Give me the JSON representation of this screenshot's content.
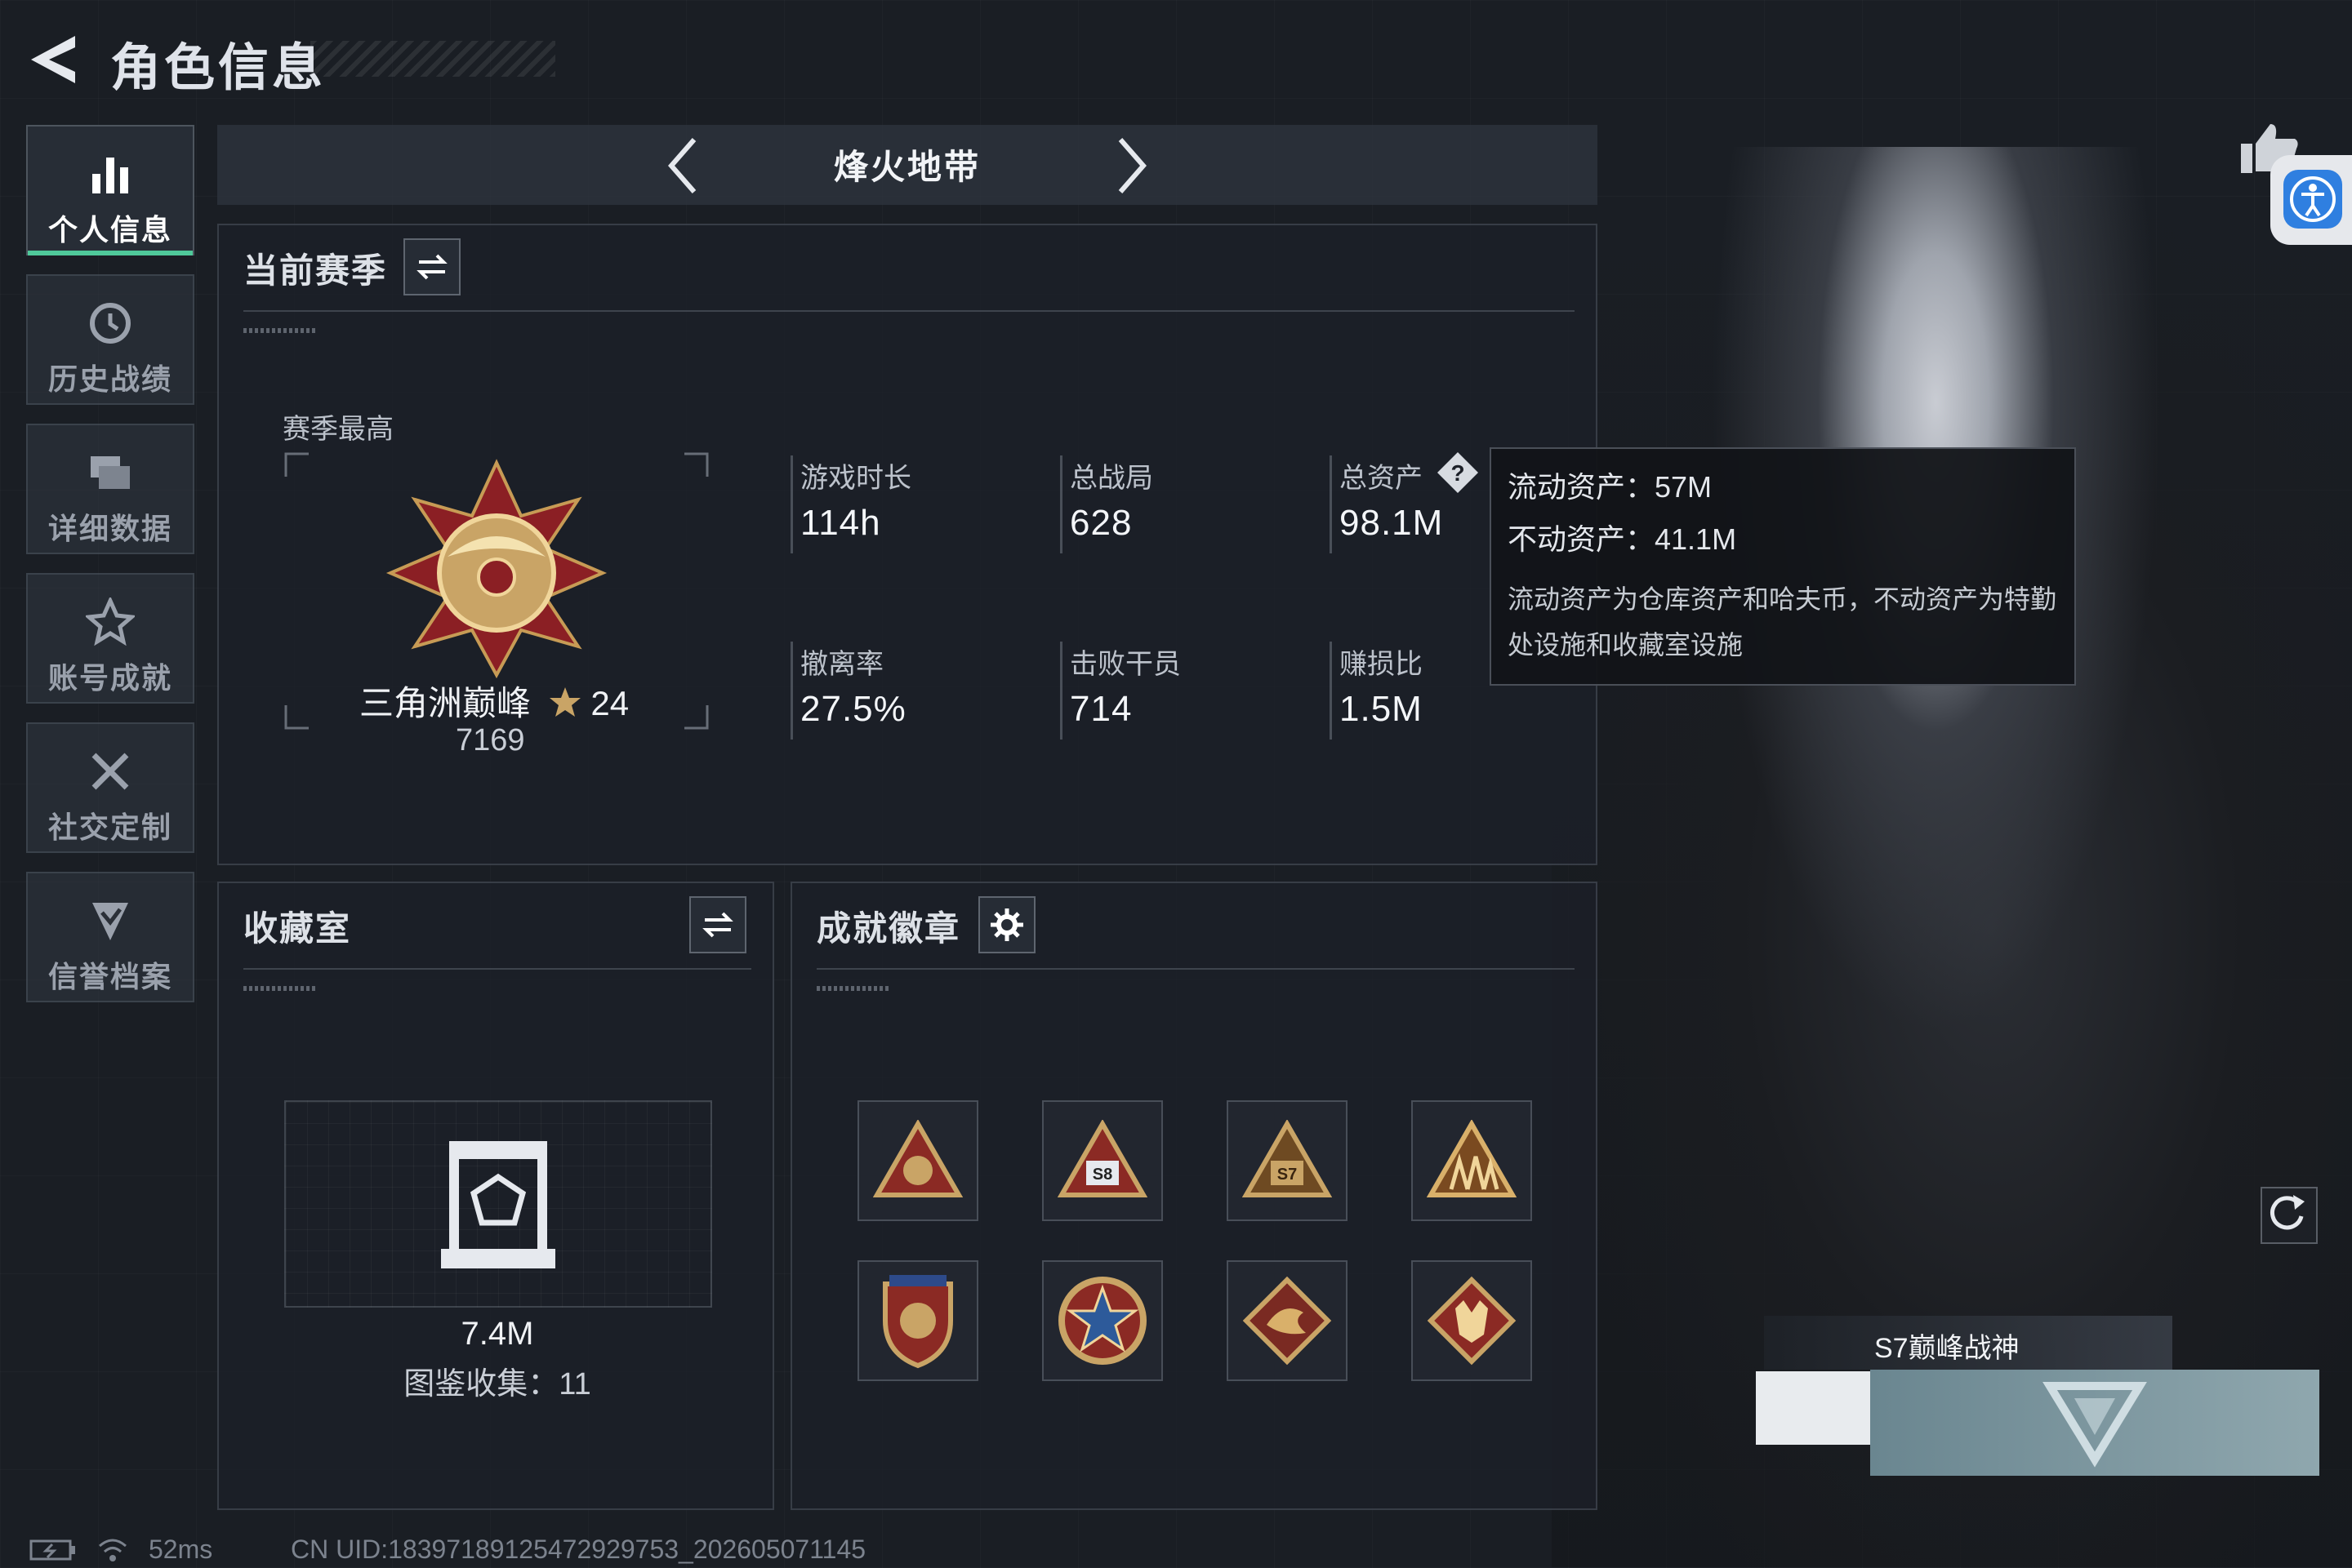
{
  "header": {
    "title": "角色信息"
  },
  "sidebar": {
    "items": [
      {
        "label": "个人信息",
        "icon": "bar-chart-icon",
        "active": true
      },
      {
        "label": "历史战绩",
        "icon": "history-clock-icon",
        "active": false
      },
      {
        "label": "详细数据",
        "icon": "folders-icon",
        "active": false
      },
      {
        "label": "账号成就",
        "icon": "achievement-star-icon",
        "active": false
      },
      {
        "label": "社交定制",
        "icon": "tools-icon",
        "active": false
      },
      {
        "label": "信誉档案",
        "icon": "shield-check-icon",
        "active": false
      }
    ]
  },
  "mode": {
    "title": "烽火地带"
  },
  "season": {
    "heading": "当前赛季",
    "best_label": "赛季最高",
    "rank_name": "三角洲巅峰",
    "stars": "24",
    "rank_score": "7169",
    "stats": [
      {
        "label": "游戏时长",
        "value": "114h"
      },
      {
        "label": "总战局",
        "value": "628"
      },
      {
        "label": "总资产",
        "value": "98.1M"
      },
      {
        "label": "撤离率",
        "value": "27.5%"
      },
      {
        "label": "击败干员",
        "value": "714"
      },
      {
        "label": "赚损比",
        "value": "1.5M"
      }
    ]
  },
  "tooltip": {
    "liquid": "流动资产：57M",
    "fixed": "不动资产：41.1M",
    "desc": "流动资产为仓库资产和哈夫币，不动资产为特勤处设施和收藏室设施"
  },
  "collection": {
    "heading": "收藏室",
    "value": "7.4M",
    "count_label": "图鉴收集：11"
  },
  "achievements": {
    "heading": "成就徽章",
    "badges": [
      {
        "icon": "triangle-badge-icon",
        "text": ""
      },
      {
        "icon": "triangle-badge-s8-icon",
        "text": "S8"
      },
      {
        "icon": "triangle-badge-s7-icon",
        "text": "S7"
      },
      {
        "icon": "triangle-soldiers-badge-icon",
        "text": ""
      },
      {
        "icon": "shield-eagle-badge-icon",
        "text": ""
      },
      {
        "icon": "star-medal-badge-icon",
        "text": ""
      },
      {
        "icon": "dragon-diamond-badge-icon",
        "text": ""
      },
      {
        "icon": "wolf-diamond-badge-icon",
        "text": ""
      }
    ]
  },
  "character": {
    "title_plate": "S7巅峰战神"
  },
  "status": {
    "ping": "52ms",
    "uid": "CN UID:18397189125472929753_202605071145"
  },
  "colors": {
    "active_tab": "#4fc99a",
    "accessibility_button": "#2f7fe0"
  }
}
